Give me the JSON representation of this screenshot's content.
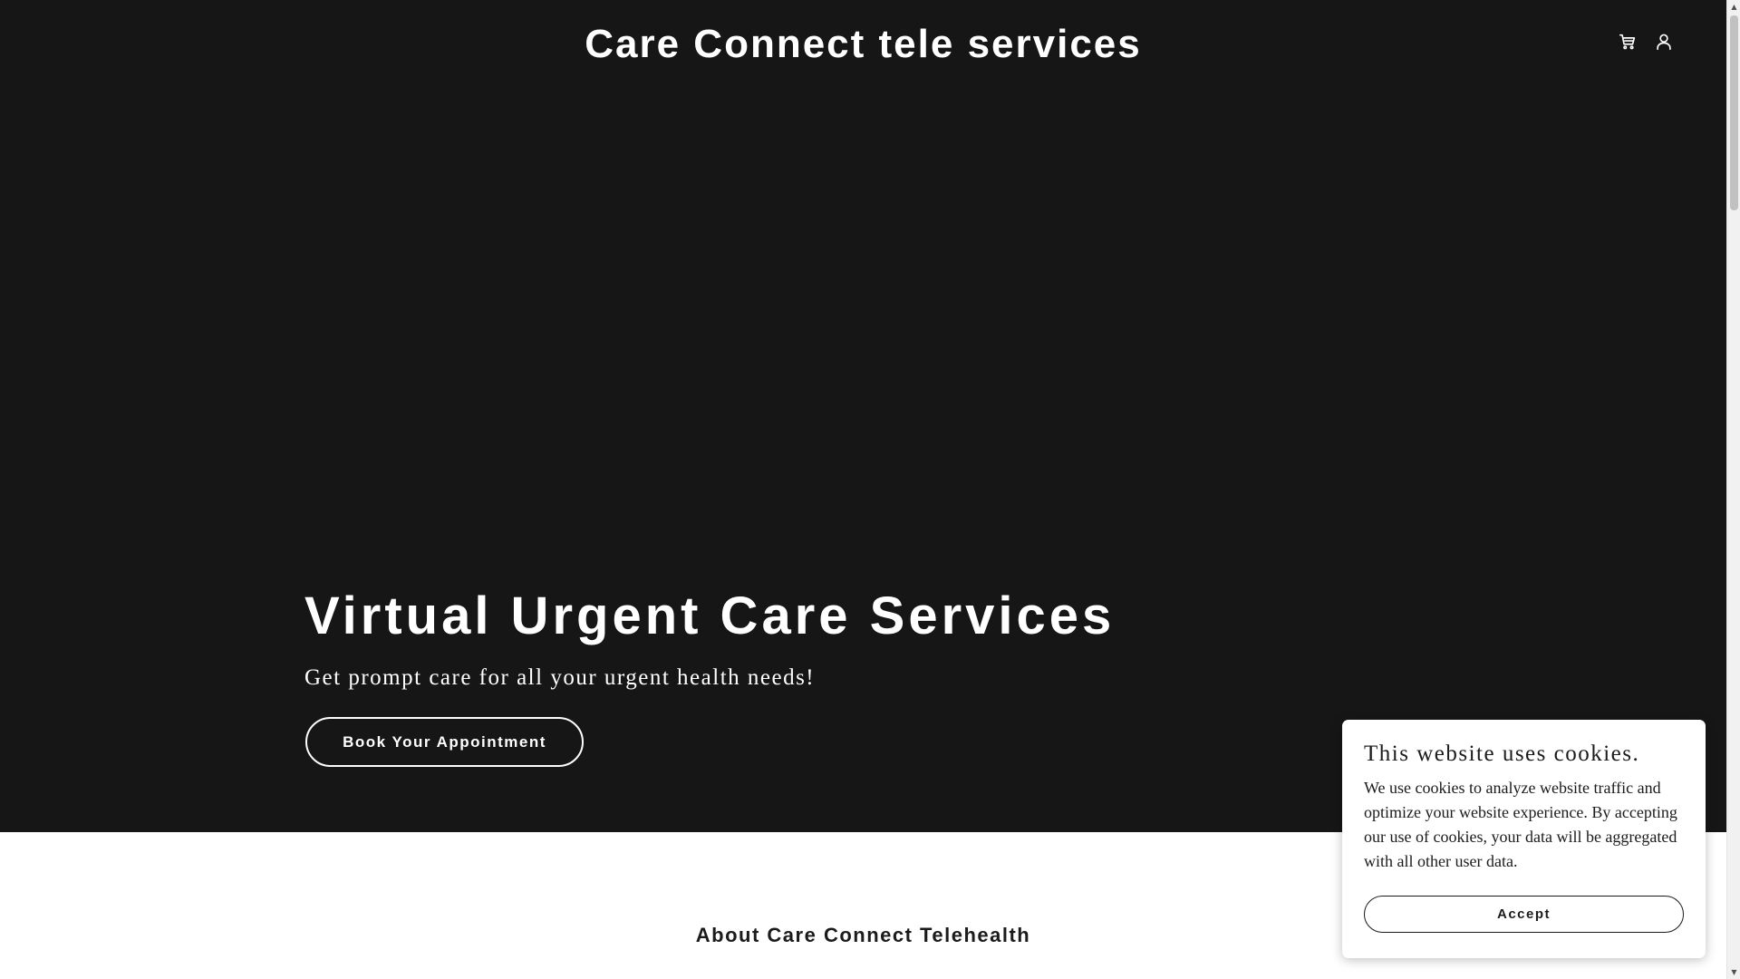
{
  "header": {
    "site_title": "Care Connect tele services",
    "icons": [
      "cart-icon",
      "user-icon"
    ]
  },
  "hero": {
    "heading": "Virtual Urgent Care Services",
    "subheading": "Get prompt care for all your urgent health needs!",
    "cta_label": "Book Your Appointment",
    "background_color": "#161616"
  },
  "about": {
    "heading": "About Care Connect Telehealth"
  },
  "cookie_banner": {
    "title": "This website uses cookies.",
    "text": "We use cookies to analyze website traffic and optimize your website experience. By accepting our use of cookies, your data will be aggregated with all other user data.",
    "accept_label": "Accept"
  },
  "scrollbar": {
    "up_arrow": "▲",
    "down_arrow": "▼"
  }
}
